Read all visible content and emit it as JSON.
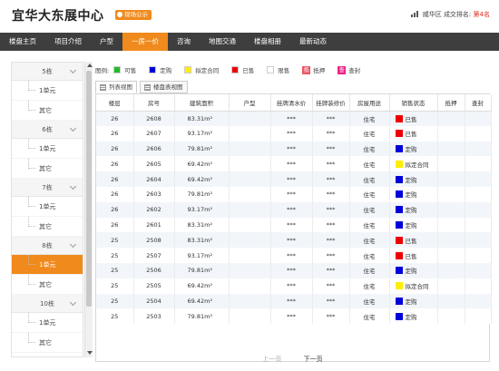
{
  "header": {
    "title": "宜华大东展中心",
    "live_badge": "现场公示",
    "district": "威华区",
    "rank_label": "成交排名:",
    "rank_value": "第4名"
  },
  "nav": {
    "items": [
      {
        "label": "楼盘主页",
        "active": false
      },
      {
        "label": "项目介绍",
        "active": false
      },
      {
        "label": "户型",
        "active": false
      },
      {
        "label": "一房一价",
        "active": true
      },
      {
        "label": "咨询",
        "active": false
      },
      {
        "label": "地图交通",
        "active": false
      },
      {
        "label": "楼盘相册",
        "active": false
      },
      {
        "label": "最新动态",
        "active": false
      }
    ]
  },
  "sidebar": {
    "groups": [
      {
        "building": "5栋",
        "units": [
          {
            "label": "1单元",
            "active": false
          },
          {
            "label": "其它",
            "active": false
          }
        ]
      },
      {
        "building": "6栋",
        "units": [
          {
            "label": "1单元",
            "active": false
          },
          {
            "label": "其它",
            "active": false
          }
        ]
      },
      {
        "building": "7栋",
        "units": [
          {
            "label": "1单元",
            "active": false
          },
          {
            "label": "其它",
            "active": false
          }
        ]
      },
      {
        "building": "8栋",
        "units": [
          {
            "label": "1单元",
            "active": true
          },
          {
            "label": "其它",
            "active": false
          }
        ]
      },
      {
        "building": "10栋",
        "units": [
          {
            "label": "1单元",
            "active": false
          },
          {
            "label": "其它",
            "active": false
          }
        ]
      }
    ]
  },
  "legend": {
    "label": "图例:",
    "items": [
      {
        "label": "可售",
        "color": "#22bb22",
        "type": "swatch"
      },
      {
        "label": "定购",
        "color": "#0000dd",
        "type": "swatch"
      },
      {
        "label": "拟定合同",
        "color": "#ffee00",
        "type": "swatch"
      },
      {
        "label": "已售",
        "color": "#ee0000",
        "type": "swatch"
      },
      {
        "label": "限售",
        "color": "#ffffff",
        "type": "swatch"
      },
      {
        "label": "抵押",
        "color": "#ee5566",
        "type": "stamp",
        "glyph": "抵"
      },
      {
        "label": "查封",
        "color": "#ee2288",
        "type": "stamp",
        "glyph": "查"
      }
    ]
  },
  "tabs": {
    "list_view": "列表视图",
    "table_view": "楼盘表视图"
  },
  "table": {
    "columns": [
      "楼层",
      "房号",
      "建筑面积",
      "户型",
      "挂牌清水价",
      "挂牌装修价",
      "房屋用途",
      "销售状态",
      "抵押",
      "查封"
    ],
    "rows": [
      {
        "floor": "26",
        "room": "2608",
        "area": "83.31m²",
        "layout": "",
        "price_clear": "***",
        "price_decor": "***",
        "use": "住宅",
        "status": "已售",
        "status_color": "#ee0000"
      },
      {
        "floor": "26",
        "room": "2607",
        "area": "93.17m²",
        "layout": "",
        "price_clear": "***",
        "price_decor": "***",
        "use": "住宅",
        "status": "已售",
        "status_color": "#ee0000"
      },
      {
        "floor": "26",
        "room": "2606",
        "area": "79.81m²",
        "layout": "",
        "price_clear": "***",
        "price_decor": "***",
        "use": "住宅",
        "status": "定购",
        "status_color": "#0000dd"
      },
      {
        "floor": "26",
        "room": "2605",
        "area": "69.42m²",
        "layout": "",
        "price_clear": "***",
        "price_decor": "***",
        "use": "住宅",
        "status": "拟定合同",
        "status_color": "#ffee00"
      },
      {
        "floor": "26",
        "room": "2604",
        "area": "69.42m²",
        "layout": "",
        "price_clear": "***",
        "price_decor": "***",
        "use": "住宅",
        "status": "定购",
        "status_color": "#0000dd"
      },
      {
        "floor": "26",
        "room": "2603",
        "area": "79.81m²",
        "layout": "",
        "price_clear": "***",
        "price_decor": "***",
        "use": "住宅",
        "status": "定购",
        "status_color": "#0000dd"
      },
      {
        "floor": "26",
        "room": "2602",
        "area": "93.17m²",
        "layout": "",
        "price_clear": "***",
        "price_decor": "***",
        "use": "住宅",
        "status": "定购",
        "status_color": "#0000dd"
      },
      {
        "floor": "26",
        "room": "2601",
        "area": "83.31m²",
        "layout": "",
        "price_clear": "***",
        "price_decor": "***",
        "use": "住宅",
        "status": "定购",
        "status_color": "#0000dd"
      },
      {
        "floor": "25",
        "room": "2508",
        "area": "83.31m²",
        "layout": "",
        "price_clear": "***",
        "price_decor": "***",
        "use": "住宅",
        "status": "已售",
        "status_color": "#ee0000"
      },
      {
        "floor": "25",
        "room": "2507",
        "area": "93.17m²",
        "layout": "",
        "price_clear": "***",
        "price_decor": "***",
        "use": "住宅",
        "status": "已售",
        "status_color": "#ee0000"
      },
      {
        "floor": "25",
        "room": "2506",
        "area": "79.81m²",
        "layout": "",
        "price_clear": "***",
        "price_decor": "***",
        "use": "住宅",
        "status": "定购",
        "status_color": "#0000dd"
      },
      {
        "floor": "25",
        "room": "2505",
        "area": "69.42m²",
        "layout": "",
        "price_clear": "***",
        "price_decor": "***",
        "use": "住宅",
        "status": "拟定合同",
        "status_color": "#ffee00"
      },
      {
        "floor": "25",
        "room": "2504",
        "area": "69.42m²",
        "layout": "",
        "price_clear": "***",
        "price_decor": "***",
        "use": "住宅",
        "status": "定购",
        "status_color": "#0000dd"
      },
      {
        "floor": "25",
        "room": "2503",
        "area": "79.81m²",
        "layout": "",
        "price_clear": "***",
        "price_decor": "***",
        "use": "住宅",
        "status": "定购",
        "status_color": "#0000dd"
      }
    ]
  },
  "pager": {
    "prev": "上一页",
    "next": "下一页"
  }
}
